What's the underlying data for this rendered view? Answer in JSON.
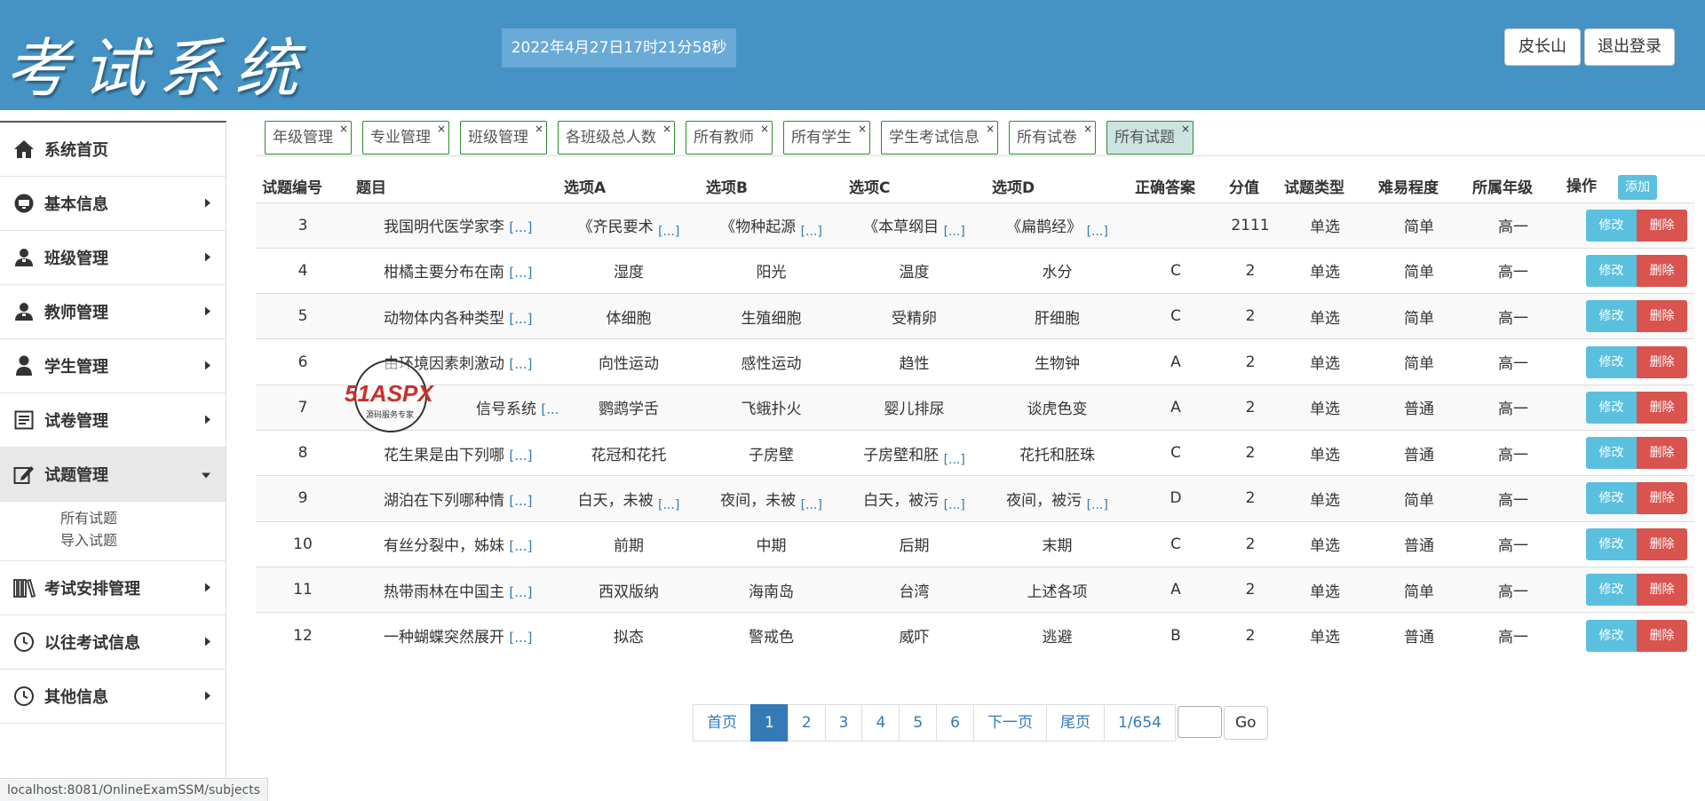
{
  "header": {
    "logo_text": "考试系统",
    "datetime": "2022年4月27日17时21分58秒",
    "user_label": "皮长山",
    "logout_label": "退出登录"
  },
  "sidebar": {
    "items": [
      {
        "label": "系统首页",
        "icon": "home-icon"
      },
      {
        "label": "基本信息",
        "icon": "dashboard-icon"
      },
      {
        "label": "班级管理",
        "icon": "users-icon"
      },
      {
        "label": "教师管理",
        "icon": "users-icon"
      },
      {
        "label": "学生管理",
        "icon": "user-icon"
      },
      {
        "label": "试卷管理",
        "icon": "list-icon"
      },
      {
        "label": "试题管理",
        "icon": "edit-icon"
      },
      {
        "label": "考试安排管理",
        "icon": "books-icon"
      },
      {
        "label": "以往考试信息",
        "icon": "clock-icon"
      },
      {
        "label": "其他信息",
        "icon": "clock-icon"
      }
    ],
    "submenu": [
      "所有试题",
      "导入试题"
    ]
  },
  "tabs": [
    "年级管理",
    "专业管理",
    "班级管理",
    "各班级总人数",
    "所有教师",
    "所有学生",
    "学生考试信息",
    "所有试卷",
    "所有试题"
  ],
  "tab_close": "×",
  "table": {
    "headers": [
      "试题编号",
      "题目",
      "选项A",
      "选项B",
      "选项C",
      "选项D",
      "正确答案",
      "分值",
      "试题类型",
      "难易程度",
      "所属年级",
      "操作"
    ],
    "add_label": "添加",
    "more": "[...]",
    "edit_label": "修改",
    "delete_label": "删除",
    "rows": [
      {
        "id": "3",
        "title": "我国明代医学家李",
        "a": "《齐民要术",
        "b": "《物种起源",
        "c": "《本草纲目",
        "d": "《扁鹊经》",
        "answer": "",
        "score": "2111",
        "type": "单选",
        "level": "简单",
        "grade": "高一"
      },
      {
        "id": "4",
        "title": "柑橘主要分布在南",
        "a": "湿度",
        "b": "阳光",
        "c": "温度",
        "d": "水分",
        "answer": "C",
        "score": "2",
        "type": "单选",
        "level": "简单",
        "grade": "高一"
      },
      {
        "id": "5",
        "title": "动物体内各种类型",
        "a": "体细胞",
        "b": "生殖细胞",
        "c": "受精卵",
        "d": "肝细胞",
        "answer": "C",
        "score": "2",
        "type": "单选",
        "level": "简单",
        "grade": "高一"
      },
      {
        "id": "6",
        "title": "由环境因素刺激动",
        "a": "向性运动",
        "b": "感性运动",
        "c": "趋性",
        "d": "生物钟",
        "answer": "A",
        "score": "2",
        "type": "单选",
        "level": "简单",
        "grade": "高一"
      },
      {
        "id": "7",
        "title": "信号系统",
        "a": "鹦鹉学舌",
        "b": "飞蛾扑火",
        "c": "婴儿排尿",
        "d": "谈虎色变",
        "answer": "A",
        "score": "2",
        "type": "单选",
        "level": "普通",
        "grade": "高一"
      },
      {
        "id": "8",
        "title": "花生果是由下列哪",
        "a": "花冠和花托",
        "b": "子房壁",
        "c": "子房壁和胚",
        "d": "花托和胚珠",
        "answer": "C",
        "score": "2",
        "type": "单选",
        "level": "普通",
        "grade": "高一"
      },
      {
        "id": "9",
        "title": "湖泊在下列哪种情",
        "a": "白天，未被",
        "b": "夜间，未被",
        "c": "白天，被污",
        "d": "夜间，被污",
        "answer": "D",
        "score": "2",
        "type": "单选",
        "level": "简单",
        "grade": "高一"
      },
      {
        "id": "10",
        "title": "有丝分裂中，姊妹",
        "a": "前期",
        "b": "中期",
        "c": "后期",
        "d": "末期",
        "answer": "C",
        "score": "2",
        "type": "单选",
        "level": "普通",
        "grade": "高一"
      },
      {
        "id": "11",
        "title": "热带雨林在中国主",
        "a": "西双版纳",
        "b": "海南岛",
        "c": "台湾",
        "d": "上述各项",
        "answer": "A",
        "score": "2",
        "type": "单选",
        "level": "简单",
        "grade": "高一"
      },
      {
        "id": "12",
        "title": "一种蝴蝶突然展开",
        "a": "拟态",
        "b": "警戒色",
        "c": "威吓",
        "d": "逃避",
        "answer": "B",
        "score": "2",
        "type": "单选",
        "level": "普通",
        "grade": "高一"
      }
    ]
  },
  "pagination": {
    "first": "首页",
    "pages": [
      "1",
      "2",
      "3",
      "4",
      "5",
      "6"
    ],
    "current": "1",
    "next": "下一页",
    "last": "尾页",
    "info": "1/654",
    "go_label": "Go"
  },
  "status_url": "localhost:8081/OnlineExamSSM/subjects",
  "watermark": {
    "brand": "51ASPX",
    "subtitle": "源码服务专家"
  },
  "colors": {
    "header_bg": "#4593c4",
    "primary": "#337ab7",
    "info": "#5bc0de",
    "danger": "#d9534f"
  }
}
